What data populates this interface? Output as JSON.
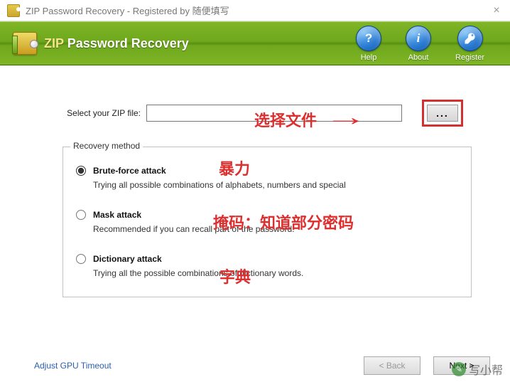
{
  "window": {
    "title": "ZIP Password Recovery - Registered by 随便填写"
  },
  "banner": {
    "product_prefix": "ZIP",
    "product_rest": " Password Recovery",
    "buttons": {
      "help": "Help",
      "about": "About",
      "register": "Register"
    }
  },
  "file": {
    "label": "Select your ZIP file:",
    "value": "",
    "browse_label": "..."
  },
  "group": {
    "title": "Recovery method",
    "options": [
      {
        "id": "brute",
        "label": "Brute-force attack",
        "desc": "Trying all possible combinations of alphabets, numbers and special",
        "checked": true
      },
      {
        "id": "mask",
        "label": "Mask attack",
        "desc": "Recommended if you can recall part of the password.",
        "checked": false
      },
      {
        "id": "dict",
        "label": "Dictionary attack",
        "desc": "Trying all the possible combinations of dictionary words.",
        "checked": false
      }
    ]
  },
  "annotations": {
    "select_file": "选择文件",
    "arrow": "→",
    "brute": "暴力",
    "mask": "掩码：知道部分密码",
    "dict": "字典"
  },
  "footer": {
    "gpu_link": "Adjust GPU Timeout",
    "back": "< Back",
    "next": "Next >"
  },
  "watermark": "写小帮"
}
